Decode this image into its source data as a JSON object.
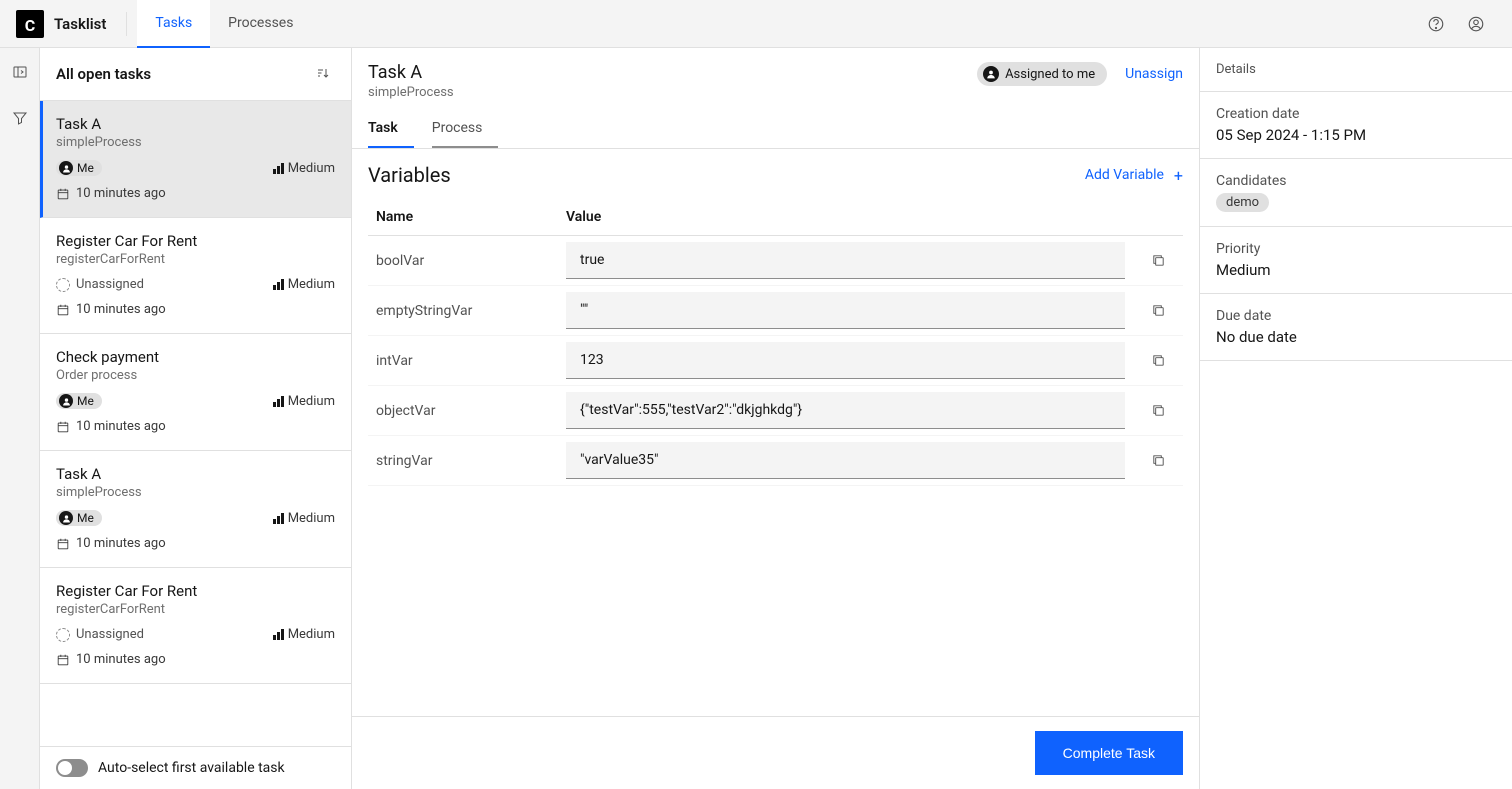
{
  "header": {
    "brand": "Tasklist",
    "tabs": [
      {
        "label": "Tasks",
        "active": true
      },
      {
        "label": "Processes",
        "active": false
      }
    ]
  },
  "taskList": {
    "title": "All open tasks",
    "items": [
      {
        "title": "Task A",
        "process": "simpleProcess",
        "assignee": "Me",
        "assigned": true,
        "priority": "Medium",
        "time": "10 minutes ago",
        "selected": true
      },
      {
        "title": "Register Car For Rent",
        "process": "registerCarForRent",
        "assignee": "Unassigned",
        "assigned": false,
        "priority": "Medium",
        "time": "10 minutes ago",
        "selected": false
      },
      {
        "title": "Check payment",
        "process": "Order process",
        "assignee": "Me",
        "assigned": true,
        "priority": "Medium",
        "time": "10 minutes ago",
        "selected": false
      },
      {
        "title": "Task A",
        "process": "simpleProcess",
        "assignee": "Me",
        "assigned": true,
        "priority": "Medium",
        "time": "10 minutes ago",
        "selected": false
      },
      {
        "title": "Register Car For Rent",
        "process": "registerCarForRent",
        "assignee": "Unassigned",
        "assigned": false,
        "priority": "Medium",
        "time": "10 minutes ago",
        "selected": false
      }
    ],
    "autoSelect": "Auto-select first available task"
  },
  "taskDetail": {
    "title": "Task A",
    "process": "simpleProcess",
    "assignedChip": "Assigned to me",
    "unassign": "Unassign",
    "tabs": [
      {
        "label": "Task",
        "active": true
      },
      {
        "label": "Process",
        "active": false
      }
    ],
    "variablesTitle": "Variables",
    "addVariable": "Add Variable",
    "columns": {
      "name": "Name",
      "value": "Value"
    },
    "variables": [
      {
        "name": "boolVar",
        "value": "true"
      },
      {
        "name": "emptyStringVar",
        "value": "\"\""
      },
      {
        "name": "intVar",
        "value": "123"
      },
      {
        "name": "objectVar",
        "value": "{\"testVar\":555,\"testVar2\":\"dkjghkdg\"}"
      },
      {
        "name": "stringVar",
        "value": "\"varValue35\""
      }
    ],
    "completeButton": "Complete Task"
  },
  "details": {
    "header": "Details",
    "creationDateLabel": "Creation date",
    "creationDate": "05 Sep 2024 - 1:15 PM",
    "candidatesLabel": "Candidates",
    "candidates": [
      "demo"
    ],
    "priorityLabel": "Priority",
    "priority": "Medium",
    "dueDateLabel": "Due date",
    "dueDate": "No due date"
  }
}
